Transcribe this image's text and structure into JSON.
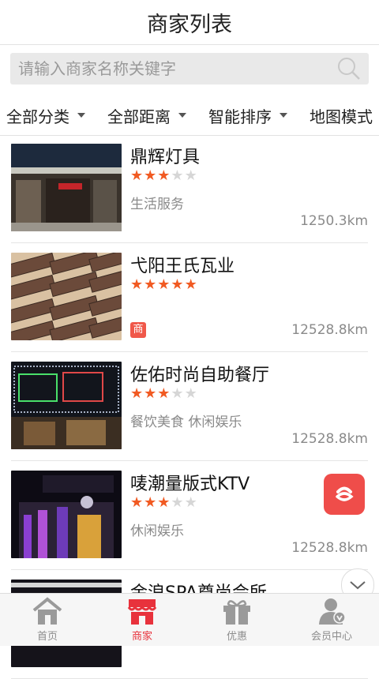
{
  "header": {
    "title": "商家列表"
  },
  "search": {
    "placeholder": "请输入商家名称关键字"
  },
  "filters": [
    {
      "label": "全部分类"
    },
    {
      "label": "全部距离"
    },
    {
      "label": "智能排序"
    },
    {
      "label": "地图模式"
    }
  ],
  "items": [
    {
      "name": "鼎辉灯具",
      "rating": 3,
      "category": "生活服务",
      "distance": "1250.3km"
    },
    {
      "name": "弋阳王氏瓦业",
      "rating": 5,
      "category": "",
      "badge": "商",
      "distance": "12528.8km"
    },
    {
      "name": "佐佑时尚自助餐厅",
      "rating": 3,
      "category": "餐饮美食 休闲娱乐",
      "distance": "12528.8km"
    },
    {
      "name": "唛潮量版式KTV",
      "rating": 3,
      "category": "休闲娱乐",
      "distance": "12528.8km"
    },
    {
      "name": "金浪SPA尊尚会所"
    }
  ],
  "tabs": [
    {
      "label": "首页",
      "icon": "home-icon"
    },
    {
      "label": "商家",
      "icon": "shop-icon",
      "active": true
    },
    {
      "label": "优惠",
      "icon": "gift-icon"
    },
    {
      "label": "会员中心",
      "icon": "member-icon"
    }
  ],
  "colors": {
    "accent": "#e8323c",
    "star": "#f15a22"
  }
}
